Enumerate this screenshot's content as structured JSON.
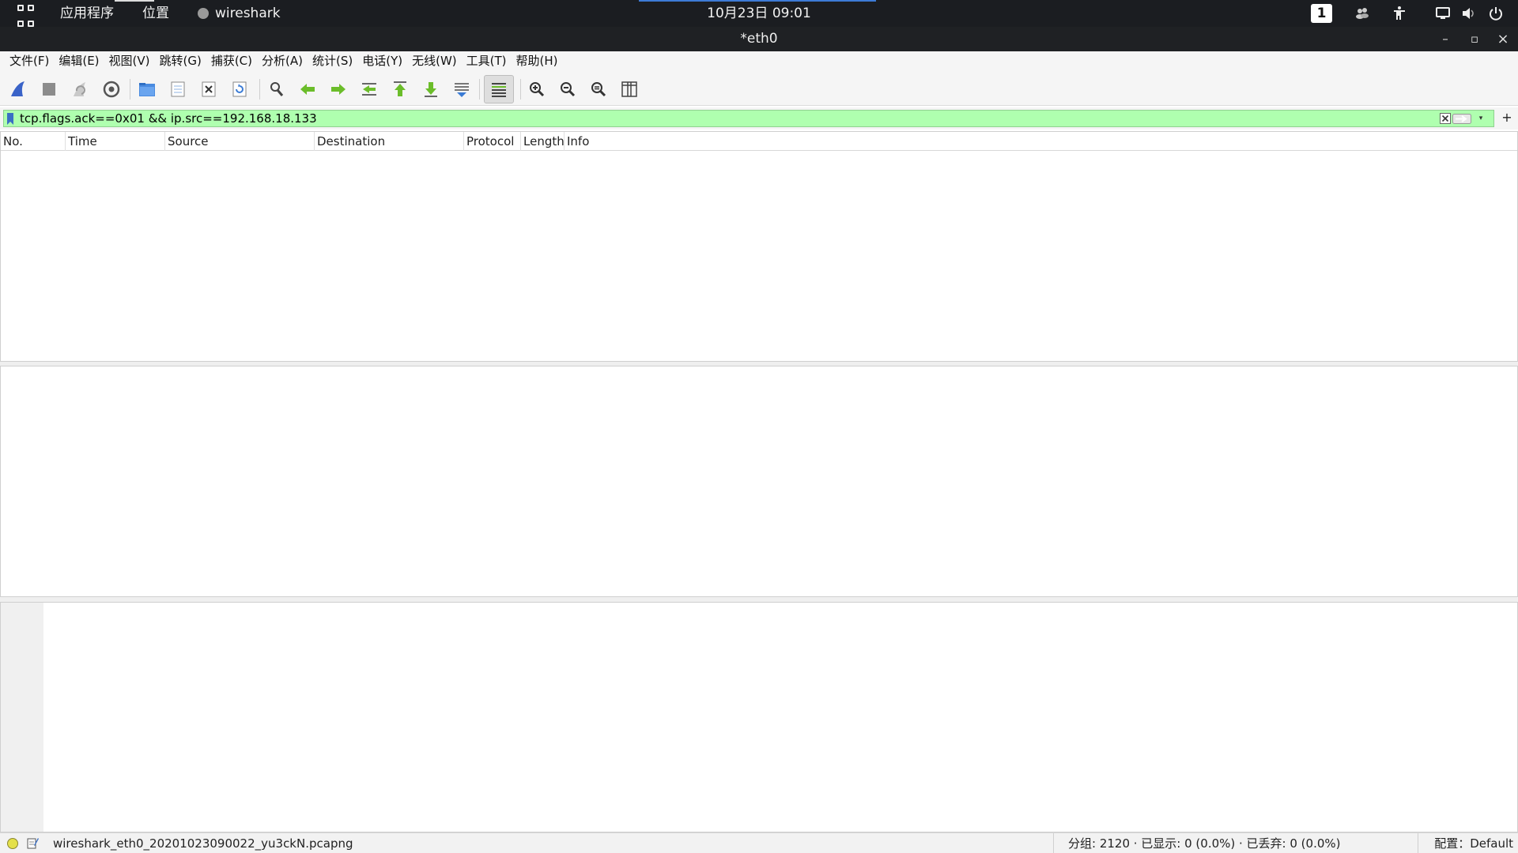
{
  "topbar": {
    "applications": "应用程序",
    "places": "位置",
    "active_app": "wireshark",
    "clock": "10月23日 09:01",
    "workspace": "1"
  },
  "window": {
    "title": "*eth0",
    "minimize": "–",
    "maximize": "▫",
    "close": "×"
  },
  "menubar": {
    "items": [
      "文件(F)",
      "编辑(E)",
      "视图(V)",
      "跳转(G)",
      "捕获(C)",
      "分析(A)",
      "统计(S)",
      "电话(Y)",
      "无线(W)",
      "工具(T)",
      "帮助(H)"
    ]
  },
  "filter": {
    "value": "tcp.flags.ack==0x01 && ip.src==192.168.18.133",
    "add": "+",
    "dropdown": "▾"
  },
  "packet_list": {
    "columns": [
      "No.",
      "Time",
      "Source",
      "Destination",
      "Protocol",
      "Length",
      "Info"
    ]
  },
  "statusbar": {
    "capture_file": "wireshark_eth0_20201023090022_yu3ckN.pcapng",
    "stats": "分组: 2120 · 已显示: 0 (0.0%) · 已丢弃: 0 (0.0%)",
    "profile": "配置：Default"
  },
  "colors": {
    "filter_valid_bg": "#afffaf",
    "topbar_bg": "#1b1d21",
    "accent": "#3d7bd6"
  }
}
